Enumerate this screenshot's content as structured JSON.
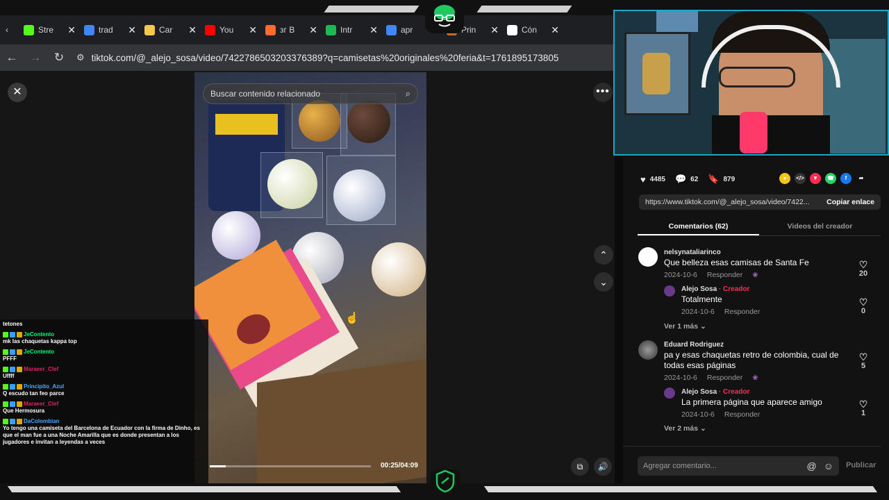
{
  "browser": {
    "tabs": [
      {
        "label": "Stre",
        "icon": "kick-icon",
        "color": "#53fc18"
      },
      {
        "label": "trad",
        "icon": "google-icon",
        "color": "#4285f4"
      },
      {
        "label": "Car",
        "icon": "emoji-icon",
        "color": "#f2c94c"
      },
      {
        "label": "You",
        "icon": "youtube-icon",
        "color": "#ff0000"
      },
      {
        "label": "зг B",
        "icon": "bookmark-icon",
        "color": "#ff6b2b"
      },
      {
        "label": "Intr",
        "icon": "spotify-icon",
        "color": "#1db954"
      },
      {
        "label": "apr",
        "icon": "google-icon",
        "color": "#4285f4"
      },
      {
        "label": "Prin",
        "icon": "avatar-icon",
        "color": "#d2691e"
      },
      {
        "label": "Cón",
        "icon": "e-icon",
        "color": "#ffffff"
      }
    ],
    "hidden_tab_fragment": "os",
    "url": "tiktok.com/@_alejo_sosa/video/7422786503203376389?q=camisetas%20originales%20feria&t=1761895173805"
  },
  "video": {
    "search_placeholder": "Buscar contenido relacionado",
    "timecode": "00:25/04:09",
    "progress": 0.1
  },
  "stats": {
    "likes": "4485",
    "comments": "62",
    "saves": "879"
  },
  "share_icons": [
    {
      "name": "coin-icon",
      "color": "#f5c518",
      "glyph": "●"
    },
    {
      "name": "embed-icon",
      "color": "#333333",
      "glyph": "</>"
    },
    {
      "name": "send-icon",
      "color": "#fe2c55",
      "glyph": "▼"
    },
    {
      "name": "whatsapp-icon",
      "color": "#25d366",
      "glyph": "☎"
    },
    {
      "name": "facebook-icon",
      "color": "#1877f2",
      "glyph": "f"
    },
    {
      "name": "share-arrow-icon",
      "color": "#121212",
      "glyph": "➦"
    }
  ],
  "link": {
    "url": "https://www.tiktok.com/@_alejo_sosa/video/7422...",
    "copy_label": "Copiar enlace"
  },
  "panel_tabs": {
    "comments": "Comentarios (62)",
    "creator_videos": "Videos del creador"
  },
  "comments": [
    {
      "user": "nelsynataliarinco",
      "text": "Que belleza esas camisas de Santa Fe",
      "date": "2024-10-6",
      "reply_label": "Responder",
      "likes": "20",
      "reply": {
        "user": "Alejo Sosa",
        "creator_tag": " · Creador",
        "text": "Totalmente",
        "date": "2024-10-6",
        "reply_label": "Responder",
        "likes": "0"
      },
      "more": "Ver 1 más"
    },
    {
      "user": "Eduard Rodriguez",
      "text": "pa y esas chaquetas retro de colombia, cual de todas esas páginas",
      "date": "2024-10-6",
      "reply_label": "Responder",
      "likes": "5",
      "reply": {
        "user": "Alejo Sosa",
        "creator_tag": " · Creador",
        "text": "La primera página que aparece amigo",
        "date": "2024-10-6",
        "reply_label": "Responder",
        "likes": "1"
      },
      "more": "Ver 2 más"
    }
  ],
  "comment_input": {
    "placeholder": "Agregar comentario...",
    "publish": "Publicar"
  },
  "chat": [
    {
      "user": "",
      "text": "tetones",
      "color": "#ffffff"
    },
    {
      "user": "JeContento",
      "text": "mk las chaquetas kappa top",
      "color": "#00ff7f"
    },
    {
      "user": "JeContento",
      "text": "PFFF",
      "color": "#00ff7f"
    },
    {
      "user": "Maraeer_Clef",
      "text": "Uffff",
      "color": "#e0245e"
    },
    {
      "user": "Principito_Azul",
      "text": "Q escudo tan feo parce",
      "color": "#4aa8ff"
    },
    {
      "user": "Maraeer_Clef",
      "text": "Que Hermosura",
      "color": "#e0245e"
    },
    {
      "user": "DaColombian",
      "text": "Yo tengo una camiseta del Barcelona de Ecuador con la firma de Dinho, es que el man fue a una Noche Amarilla que es donde presentan a los jugadores e invitan a leyendas a veces",
      "color": "#4aa8ff"
    }
  ]
}
